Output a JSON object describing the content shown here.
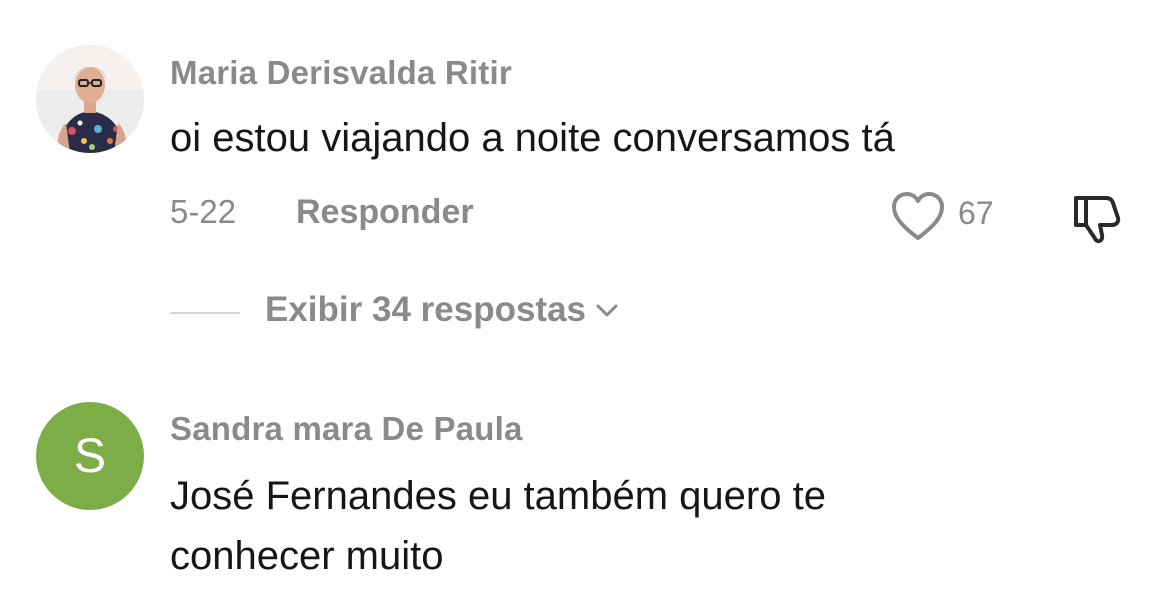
{
  "comments": [
    {
      "username": "Maria Derisvalda Ritir",
      "text_lines": [
        "oi estou viajando a noite conversamos tá"
      ],
      "date": "5-22",
      "reply_label": "Responder",
      "like_count": "67",
      "view_replies_label": "Exibir 34 respostas"
    },
    {
      "username": "Sandra mara De Paula",
      "avatar_letter": "S",
      "avatar_color": "#7cad47",
      "text_lines": [
        "José Fernandes eu também quero te",
        "conhecer muito"
      ]
    }
  ],
  "colors": {
    "secondary_text": "#8a8a8a",
    "primary_text": "#161616"
  },
  "icons": [
    "heart-icon",
    "dislike-icon",
    "chevron-down-icon"
  ]
}
